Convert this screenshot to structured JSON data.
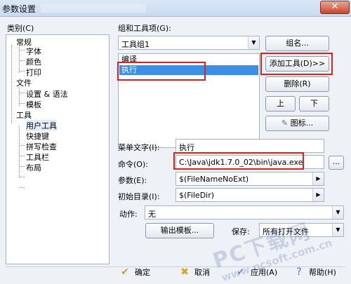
{
  "window": {
    "title": "参数设置",
    "close_glyph": "✕"
  },
  "category": {
    "label": "类别(C)",
    "tree": [
      {
        "label": "常规"
      },
      {
        "label": "字体"
      },
      {
        "label": "颜色"
      },
      {
        "label": "打印"
      },
      {
        "label": "文件"
      },
      {
        "label": "设置 & 语法"
      },
      {
        "label": "模板"
      },
      {
        "label": "工具"
      },
      {
        "label": "用户工具"
      },
      {
        "label": "快捷键"
      },
      {
        "label": "拼写检查"
      },
      {
        "label": "工具栏"
      },
      {
        "label": "布局"
      }
    ]
  },
  "group": {
    "label": "组和工具项(G):",
    "selected": "工具组1",
    "items": [
      "编译",
      "执行"
    ]
  },
  "buttons": {
    "group_name": "组名...",
    "add_tool": "添加工具(D)>>",
    "delete": "删除(R)",
    "up": "上",
    "down": "下",
    "icon": "图标..."
  },
  "fields": {
    "menu_text_label": "菜单文字(I):",
    "menu_text_value": "执行",
    "command_label": "命令(O):",
    "command_value": "C:\\Java\\jdk1.7.0_02\\bin\\java.exe",
    "browse": "...",
    "params_label": "参数(E):",
    "params_value": "$(FileNameNoExt)",
    "init_dir_label": "初始目录(I):",
    "init_dir_value": "$(FileDir)",
    "action_label": "动作:",
    "action_value": "无",
    "output_template": "输出模板...",
    "save_label": "保存:",
    "save_value": "所有打开文件"
  },
  "footer": {
    "ok": "确定",
    "cancel": "取消",
    "apply": "应用(A)",
    "help": "帮助(H)"
  },
  "watermark": {
    "main": "PC下载网",
    "url": "www.pcsoft.com.cn"
  },
  "colors": {
    "highlight": "#3d8ee6",
    "annotation": "#e02020"
  }
}
